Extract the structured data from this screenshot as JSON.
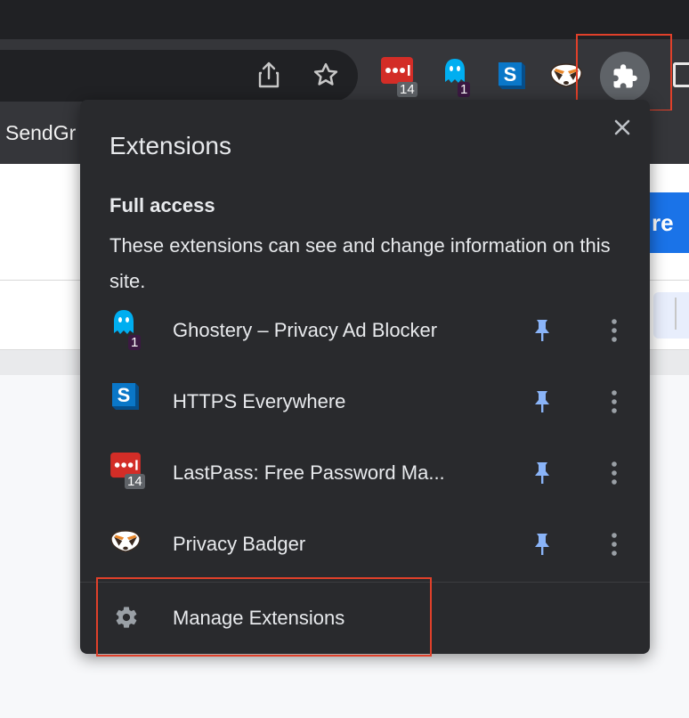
{
  "toolbar": {
    "bookmark_label": "SendGr",
    "extensions": [
      {
        "name": "LastPass",
        "badge": "14"
      },
      {
        "name": "Ghostery",
        "badge": "1"
      },
      {
        "name": "HTTPS Everywhere",
        "badge": ""
      },
      {
        "name": "Privacy Badger",
        "badge": ""
      }
    ]
  },
  "page": {
    "partial_button_text": "re"
  },
  "popup": {
    "title": "Extensions",
    "section": {
      "heading": "Full access",
      "description": "These extensions can see and change information on this site."
    },
    "items": [
      {
        "name": "Ghostery – Privacy Ad Blocker",
        "badge": "1",
        "icon": "ghostery-icon",
        "pinned": true
      },
      {
        "name": "HTTPS Everywhere",
        "badge": "",
        "icon": "https-everywhere-icon",
        "pinned": true
      },
      {
        "name": "LastPass: Free Password Ma...",
        "badge": "14",
        "icon": "lastpass-icon",
        "pinned": true
      },
      {
        "name": "Privacy Badger",
        "badge": "",
        "icon": "privacy-badger-icon",
        "pinned": true
      }
    ],
    "manage_label": "Manage Extensions"
  },
  "colors": {
    "toolbar_bg": "#35363a",
    "popup_bg": "#292a2d",
    "pin_color": "#8ab4f8",
    "highlight": "#e0402a",
    "lastpass_red": "#d32d27",
    "ghostery_blue": "#00aef0",
    "https_blue": "#0a77c8"
  }
}
